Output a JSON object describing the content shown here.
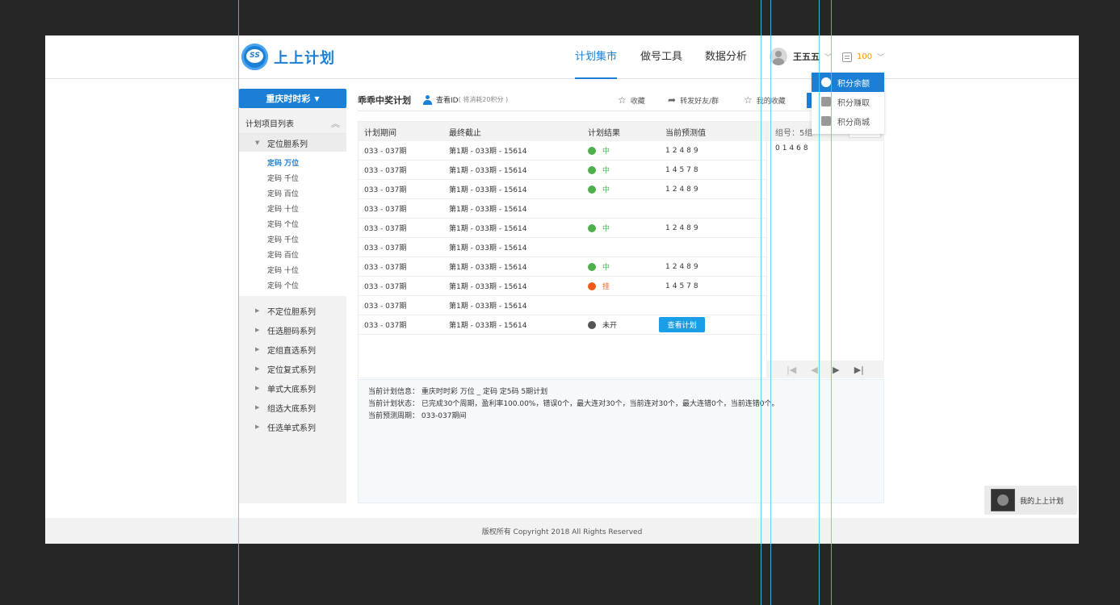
{
  "colors": {
    "brand": "#1b7fd6",
    "win": "#4caf50",
    "lose": "#f05a1a",
    "pending": "#555555",
    "points": "#f39800"
  },
  "header": {
    "logo_mark": "SS",
    "logo_text": "上上计划",
    "nav": [
      {
        "label": "计划集市",
        "active": true
      },
      {
        "label": "做号工具",
        "active": false
      },
      {
        "label": "数据分析",
        "active": false
      }
    ],
    "username": "王五五",
    "points": "100"
  },
  "points_menu": [
    {
      "label": "积分余额",
      "icon": "money-bag-icon",
      "active": true
    },
    {
      "label": "积分赚取",
      "icon": "piggy-bank-icon",
      "active": false
    },
    {
      "label": "积分商城",
      "icon": "shop-icon",
      "active": false
    }
  ],
  "sidebar": {
    "lottery": "重庆时时彩",
    "list_title": "计划项目列表",
    "open_group": "定位胆系列",
    "sub_items": [
      {
        "label": "定码 万位",
        "active": true
      },
      {
        "label": "定码 千位",
        "active": false
      },
      {
        "label": "定码 百位",
        "active": false
      },
      {
        "label": "定码 十位",
        "active": false
      },
      {
        "label": "定码 个位",
        "active": false
      },
      {
        "label": "定码 千位",
        "active": false
      },
      {
        "label": "定码 百位",
        "active": false
      },
      {
        "label": "定码 十位",
        "active": false
      },
      {
        "label": "定码 个位",
        "active": false
      }
    ],
    "categories": [
      "不定位胆系列",
      "任选胆码系列",
      "定组直选系列",
      "定位复式系列",
      "单式大底系列",
      "组选大底系列",
      "任选单式系列"
    ]
  },
  "toolbar": {
    "title": "乖乖中奖计划",
    "view_id": "查看ID",
    "view_id_note": "( 将消耗20积分 )",
    "favorite": "收藏",
    "share": "转发好友/群",
    "my_favorites": "我的收藏"
  },
  "table": {
    "headers": [
      "计划期间",
      "最终截止",
      "计划结果",
      "当前预测值"
    ],
    "group_label": "组号：5组",
    "group_value": "01468",
    "view_plan": "查看计划",
    "rows": [
      {
        "period": "033 - 037期",
        "deadline": "第1期 - 033期 - 15614",
        "status": "win",
        "result": "中",
        "prediction": "12489"
      },
      {
        "period": "033 - 037期",
        "deadline": "第1期 - 033期 - 15614",
        "status": "win",
        "result": "中",
        "prediction": "14578"
      },
      {
        "period": "033 - 037期",
        "deadline": "第1期 - 033期 - 15614",
        "status": "win",
        "result": "中",
        "prediction": "12489"
      },
      {
        "period": "033 - 037期",
        "deadline": "第1期 - 033期 - 15614",
        "status": "",
        "result": "",
        "prediction": ""
      },
      {
        "period": "033 - 037期",
        "deadline": "第1期 - 033期 - 15614",
        "status": "win",
        "result": "中",
        "prediction": "12489"
      },
      {
        "period": "033 - 037期",
        "deadline": "第1期 - 033期 - 15614",
        "status": "",
        "result": "",
        "prediction": ""
      },
      {
        "period": "033 - 037期",
        "deadline": "第1期 - 033期 - 15614",
        "status": "win",
        "result": "中",
        "prediction": "12489"
      },
      {
        "period": "033 - 037期",
        "deadline": "第1期 - 033期 - 15614",
        "status": "lose",
        "result": "挂",
        "prediction": "14578"
      },
      {
        "period": "033 - 037期",
        "deadline": "第1期 - 033期 - 15614",
        "status": "",
        "result": "",
        "prediction": ""
      },
      {
        "period": "033 - 037期",
        "deadline": "第1期 - 033期 - 15614",
        "status": "pending",
        "result": "未开",
        "prediction": "",
        "action": true
      }
    ]
  },
  "info": {
    "line1": "当前计划信息： 重庆时时彩   万位 _ 定码   定5码   5期计划",
    "line2": "当前计划状态： 已完成30个周期，盈利率100.00%，错误0个，最大连对30个，当前连对30个，最大连错0个，当前连错0个。",
    "line3": "当前预测周期： 033-037期间"
  },
  "footer": "版权所有   Copyright 2018 All Rights Reserved",
  "my_plan": "我的上上计划"
}
